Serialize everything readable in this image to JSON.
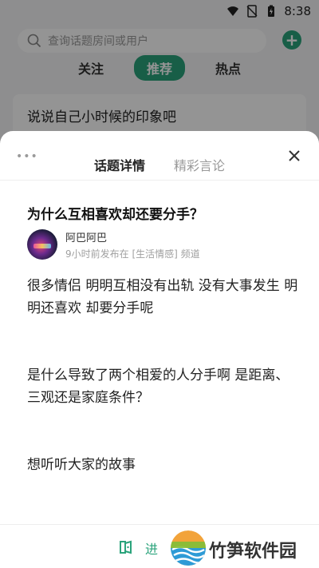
{
  "status_bar": {
    "time": "8:38",
    "icons": [
      "wifi-icon",
      "no-sim-icon",
      "battery-charging-icon"
    ]
  },
  "background": {
    "search_placeholder": "查询话题房间或用户",
    "tabs": [
      {
        "label": "关注",
        "active": false
      },
      {
        "label": "推荐",
        "active": true
      },
      {
        "label": "热点",
        "active": false
      }
    ],
    "card_text": "说说自己小时候的印象吧"
  },
  "sheet": {
    "more_icon": "•••",
    "tabs": [
      {
        "label": "话题详情",
        "active": true
      },
      {
        "label": "精彩言论",
        "active": false
      }
    ],
    "topic_title": "为什么互相喜欢却还要分手？",
    "author": {
      "name": "阿巴阿巴",
      "meta": "9小时前发布在 [生活情感] 频道"
    },
    "paragraphs": [
      "很多情侣 明明互相没有出轨 没有大事发生 明明还喜欢 却要分手呢",
      "是什么导致了两个相爱的人分手啊 是距离、三观还是家庭条件？",
      "想听听大家的故事"
    ],
    "enter_label": "进"
  },
  "watermark": {
    "text": "竹笋软件园"
  },
  "colors": {
    "accent": "#2aa37b"
  }
}
